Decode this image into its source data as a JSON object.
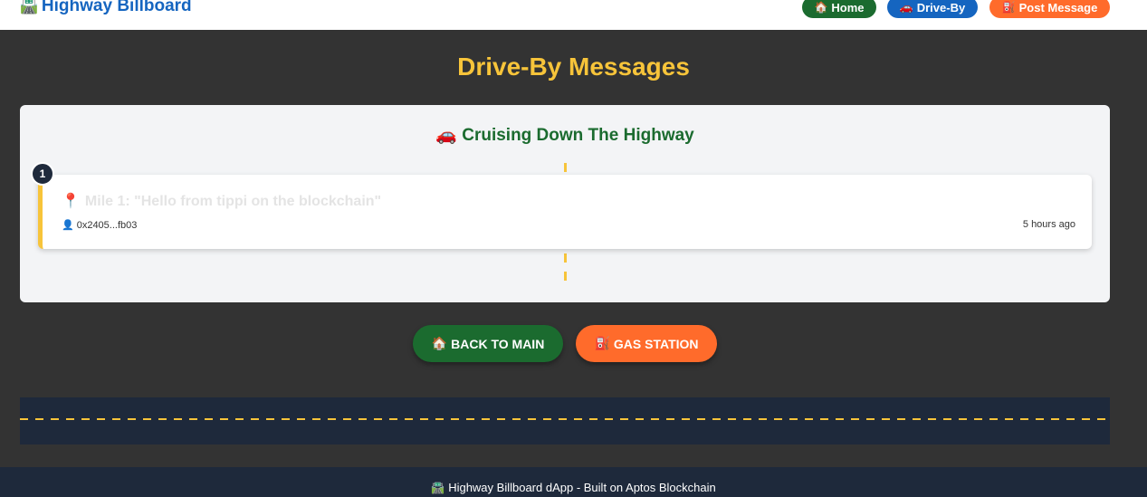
{
  "header": {
    "brand_icon": "🛣️",
    "brand_text": "Highway Billboard",
    "nav": [
      {
        "icon": "🏠",
        "label": "Home",
        "color": "#1b6b2f"
      },
      {
        "icon": "🚗",
        "label": "Drive-By",
        "color": "#1565c0"
      },
      {
        "icon": "⛽",
        "label": "Post Message",
        "color": "#ff6b2b"
      }
    ]
  },
  "page": {
    "title": "Drive-By Messages"
  },
  "highway_card": {
    "icon": "🚗",
    "title": "Cruising Down The Highway",
    "messages": [
      {
        "number": "1",
        "pin_icon": "📍",
        "text": "Mile 1: \"Hello from tippi on the blockchain\"",
        "user_icon": "👤",
        "address": "0x2405...fb03",
        "time": "5 hours ago"
      }
    ]
  },
  "actions": {
    "back": {
      "icon": "🏠",
      "label": "BACK TO MAIN",
      "color": "#1b6b2f"
    },
    "gas": {
      "icon": "⛽",
      "label": "GAS STATION",
      "color": "#ff6b2b"
    }
  },
  "footer": {
    "icon": "🛣️",
    "text": "Highway Billboard dApp - Built on Aptos Blockchain"
  },
  "colors": {
    "background": "#333333",
    "accent_yellow": "#f7c43a",
    "road": "#1e293b"
  }
}
